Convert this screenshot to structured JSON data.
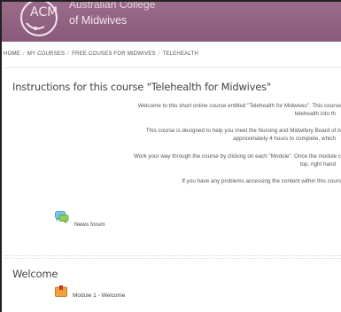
{
  "header": {
    "brand_line1": "Australian College",
    "brand_line2": "of Midwives",
    "logo_text": "ACM"
  },
  "breadcrumb": {
    "items": [
      "HOME",
      "MY COURSES",
      "FREE COUSES FOR MIDWIVES",
      "TELEHEALTH"
    ]
  },
  "course": {
    "title": "Instructions for this course \"Telehealth for Midwives\"",
    "paragraphs": [
      "Welcome to this short online course entitled \"Telehealth for Midwives\". This course",
      "telehealth into th",
      "This course is designed to help you meet the Nursing and Midwifery Board of A",
      "approximately 4 hours to complete, which",
      "Work your way through the course by clicking on each \"Module\". Once the module c",
      "top, right hand",
      "If you have any problems accessing the content within this cours"
    ],
    "forum_label": "News forum"
  },
  "welcome": {
    "title": "Welcome",
    "module_label": "Module 1 - Welcome"
  },
  "colors": {
    "header": "#8a5a7a",
    "text": "#444444"
  }
}
